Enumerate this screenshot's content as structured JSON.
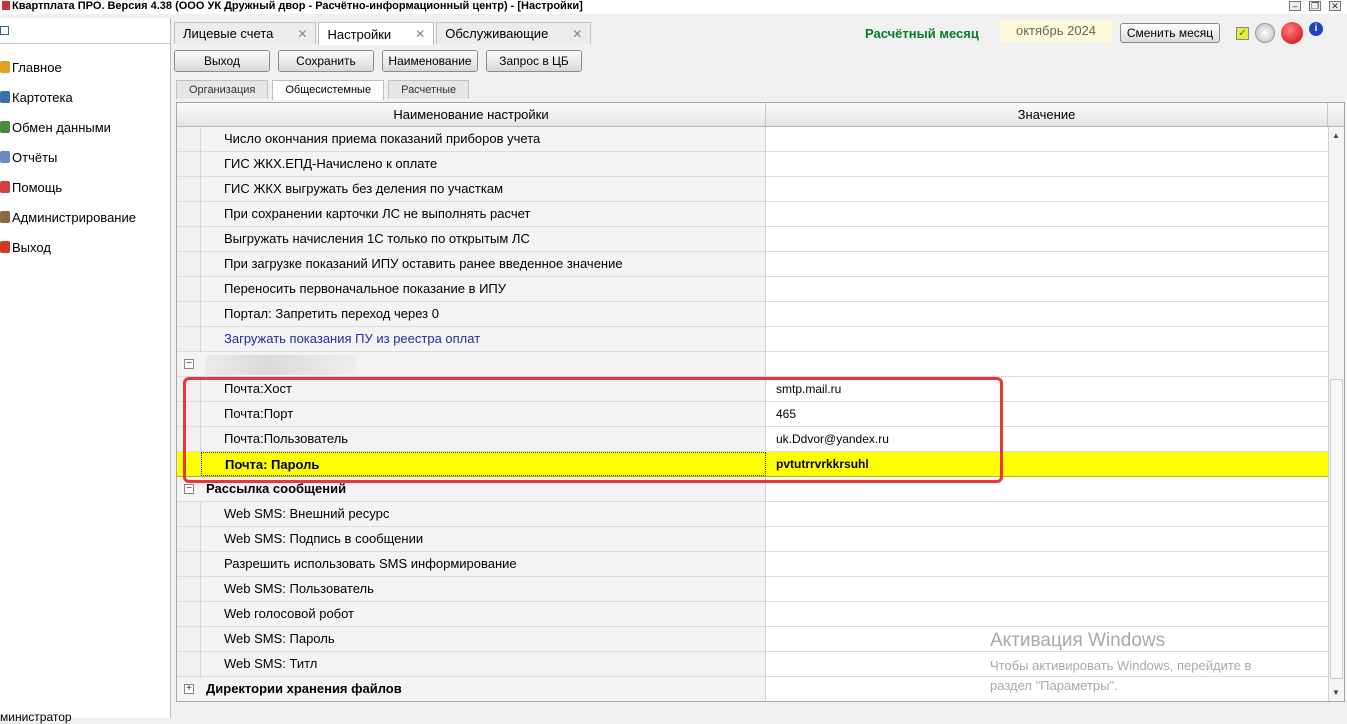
{
  "window": {
    "title": "Квартплата ПРО.  Версия 4.38 (ООО УК Дружный двор - Расчётно-информационный центр) - [Настройки]"
  },
  "sidebar": {
    "items": [
      {
        "label": "Главное",
        "icon": "home-icon",
        "color": "#e0a020"
      },
      {
        "label": "Картотека",
        "icon": "cards-icon",
        "color": "#3a6fb0"
      },
      {
        "label": "Обмен данными",
        "icon": "exchange-icon",
        "color": "#4a8a40"
      },
      {
        "label": "Отчёты",
        "icon": "reports-icon",
        "color": "#6a8abf"
      },
      {
        "label": "Помощь",
        "icon": "help-icon",
        "color": "#d04040"
      },
      {
        "label": "Администрирование",
        "icon": "admin-icon",
        "color": "#8a6a40"
      },
      {
        "label": "Выход",
        "icon": "exit-icon",
        "color": "#d03a20"
      }
    ],
    "footer": "министратор"
  },
  "tabs": [
    {
      "label": "Лицевые счета",
      "close": "✕",
      "active": false
    },
    {
      "label": "Настройки",
      "close": "✕",
      "active": true
    },
    {
      "label": "Обслуживающие",
      "close": "✕",
      "active": false
    }
  ],
  "header": {
    "month_label": "Расчётный месяц",
    "month_value": "октябрь 2024",
    "change_month": "Сменить месяц"
  },
  "toolbar": {
    "exit": "Выход",
    "save": "Сохранить",
    "naming": "Наименование",
    "cb_request": "Запрос в ЦБ"
  },
  "subtabs": [
    {
      "label": "Организация",
      "active": false
    },
    {
      "label": "Общесистемные",
      "active": true
    },
    {
      "label": "Расчетные",
      "active": false
    }
  ],
  "grid": {
    "col_name": "Наименование настройки",
    "col_value": "Значение",
    "rows": [
      {
        "type": "item",
        "name": "Число окончания приема показаний приборов учета",
        "value": ""
      },
      {
        "type": "item",
        "name": "ГИС ЖКХ.ЕПД-Начислено к оплате",
        "value": ""
      },
      {
        "type": "item",
        "name": "ГИС ЖКХ выгружать без деления по участкам",
        "value": ""
      },
      {
        "type": "item",
        "name": "При сохранении карточки ЛС не выполнять расчет",
        "value": ""
      },
      {
        "type": "item",
        "name": "Выгружать начисления 1С только по открытым ЛС",
        "value": ""
      },
      {
        "type": "item",
        "name": "При загрузке показаний ИПУ оставить ранее введенное значение",
        "value": ""
      },
      {
        "type": "item",
        "name": "Переносить первоначальное показание в ИПУ",
        "value": ""
      },
      {
        "type": "item",
        "name": "Портал: Запретить переход через 0",
        "value": ""
      },
      {
        "type": "link",
        "name": "Загружать показания ПУ из реестра оплат",
        "value": ""
      },
      {
        "type": "group",
        "name": "",
        "value": "",
        "toggle": "−"
      },
      {
        "type": "item",
        "name": "Почта:Хост",
        "value": "smtp.mail.ru"
      },
      {
        "type": "item",
        "name": "Почта:Порт",
        "value": "465"
      },
      {
        "type": "item",
        "name": "Почта:Пользователь",
        "value": "uk.Ddvor@yandex.ru"
      },
      {
        "type": "highlight",
        "name": "Почта: Пароль",
        "value": "pvtutrrvrkkrsuhl"
      },
      {
        "type": "group",
        "name": "Рассылка сообщений",
        "value": "",
        "toggle": "−"
      },
      {
        "type": "item",
        "name": "Web SMS: Внешний ресурс",
        "value": ""
      },
      {
        "type": "item",
        "name": "Web SMS: Подпись в сообщении",
        "value": ""
      },
      {
        "type": "item",
        "name": "Разрешить использовать SMS информирование",
        "value": ""
      },
      {
        "type": "item",
        "name": "Web SMS: Пользователь",
        "value": ""
      },
      {
        "type": "item",
        "name": "Web голосовой робот",
        "value": ""
      },
      {
        "type": "item",
        "name": "Web SMS: Пароль",
        "value": ""
      },
      {
        "type": "item",
        "name": "Web SMS: Титл",
        "value": ""
      },
      {
        "type": "group",
        "name": "Директории хранения файлов",
        "value": "",
        "toggle": "+"
      }
    ]
  },
  "watermark": {
    "title": "Активация Windows",
    "line1": "Чтобы активировать Windows, перейдите в",
    "line2": "раздел \"Параметры\"."
  },
  "colors": {
    "highlight": "#ffff00",
    "annotation": "#e53935",
    "month_label": "#0b7a2a",
    "link": "#2a2aa8"
  }
}
